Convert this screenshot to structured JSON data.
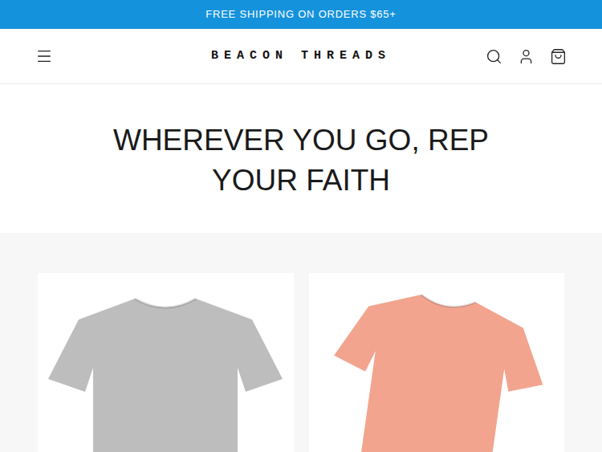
{
  "announcement": "FREE SHIPPING ON ORDERS $65+",
  "header": {
    "logo": "BEACON THREADS"
  },
  "hero": {
    "heading_lines": [
      "WHEREVER YOU GO, REP",
      "YOUR FAITH"
    ]
  },
  "products": [
    {
      "color": "#bdbdbd"
    },
    {
      "color": "#f2a48f"
    }
  ]
}
